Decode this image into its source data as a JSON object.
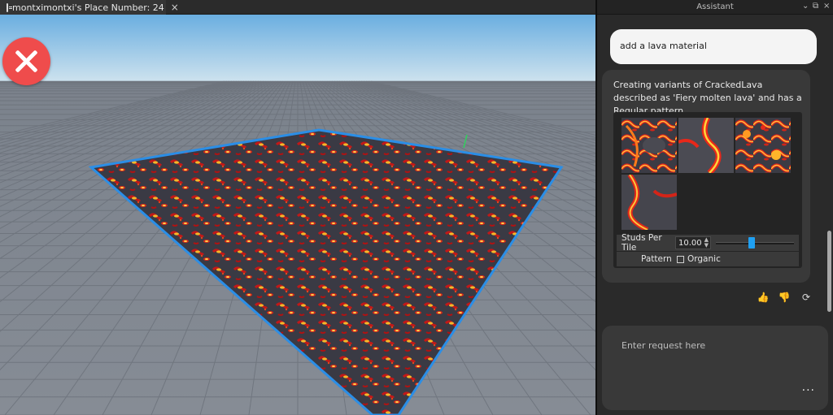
{
  "tab": {
    "title": "montximontxi's Place Number: 24",
    "close_glyph": "×",
    "icon": "document-icon"
  },
  "viewport": {
    "stop_icon": "close-x-icon",
    "colors": {
      "sky_top": "#6ab0e0",
      "sky_bottom": "#cfe3ee",
      "floor": "#808791",
      "lava_glow": "#f0a020",
      "selection": "#2b8ee6"
    }
  },
  "assistant": {
    "title": "Assistant",
    "header_icons": {
      "dropdown": "chevron-down-icon",
      "popout": "popout-icon",
      "close": "close-icon"
    },
    "user_message": "add a lava material",
    "bot_message": "Creating variants of CrackedLava described as 'Fiery molten lava' and has a Regular pattern.",
    "material": {
      "variant_count": 4,
      "studs_per_tile_label": "Studs Per Tile",
      "studs_per_tile_value": "10.00",
      "slider_fraction": 0.46,
      "pattern_label": "Pattern",
      "pattern_option": "Organic",
      "pattern_organic_checked": false
    },
    "actions": {
      "thumbs_up": "thumbs-up-icon",
      "thumbs_down": "thumbs-down-icon",
      "regenerate": "refresh-icon"
    },
    "request": {
      "placeholder": "Enter request here",
      "more": "..."
    }
  }
}
